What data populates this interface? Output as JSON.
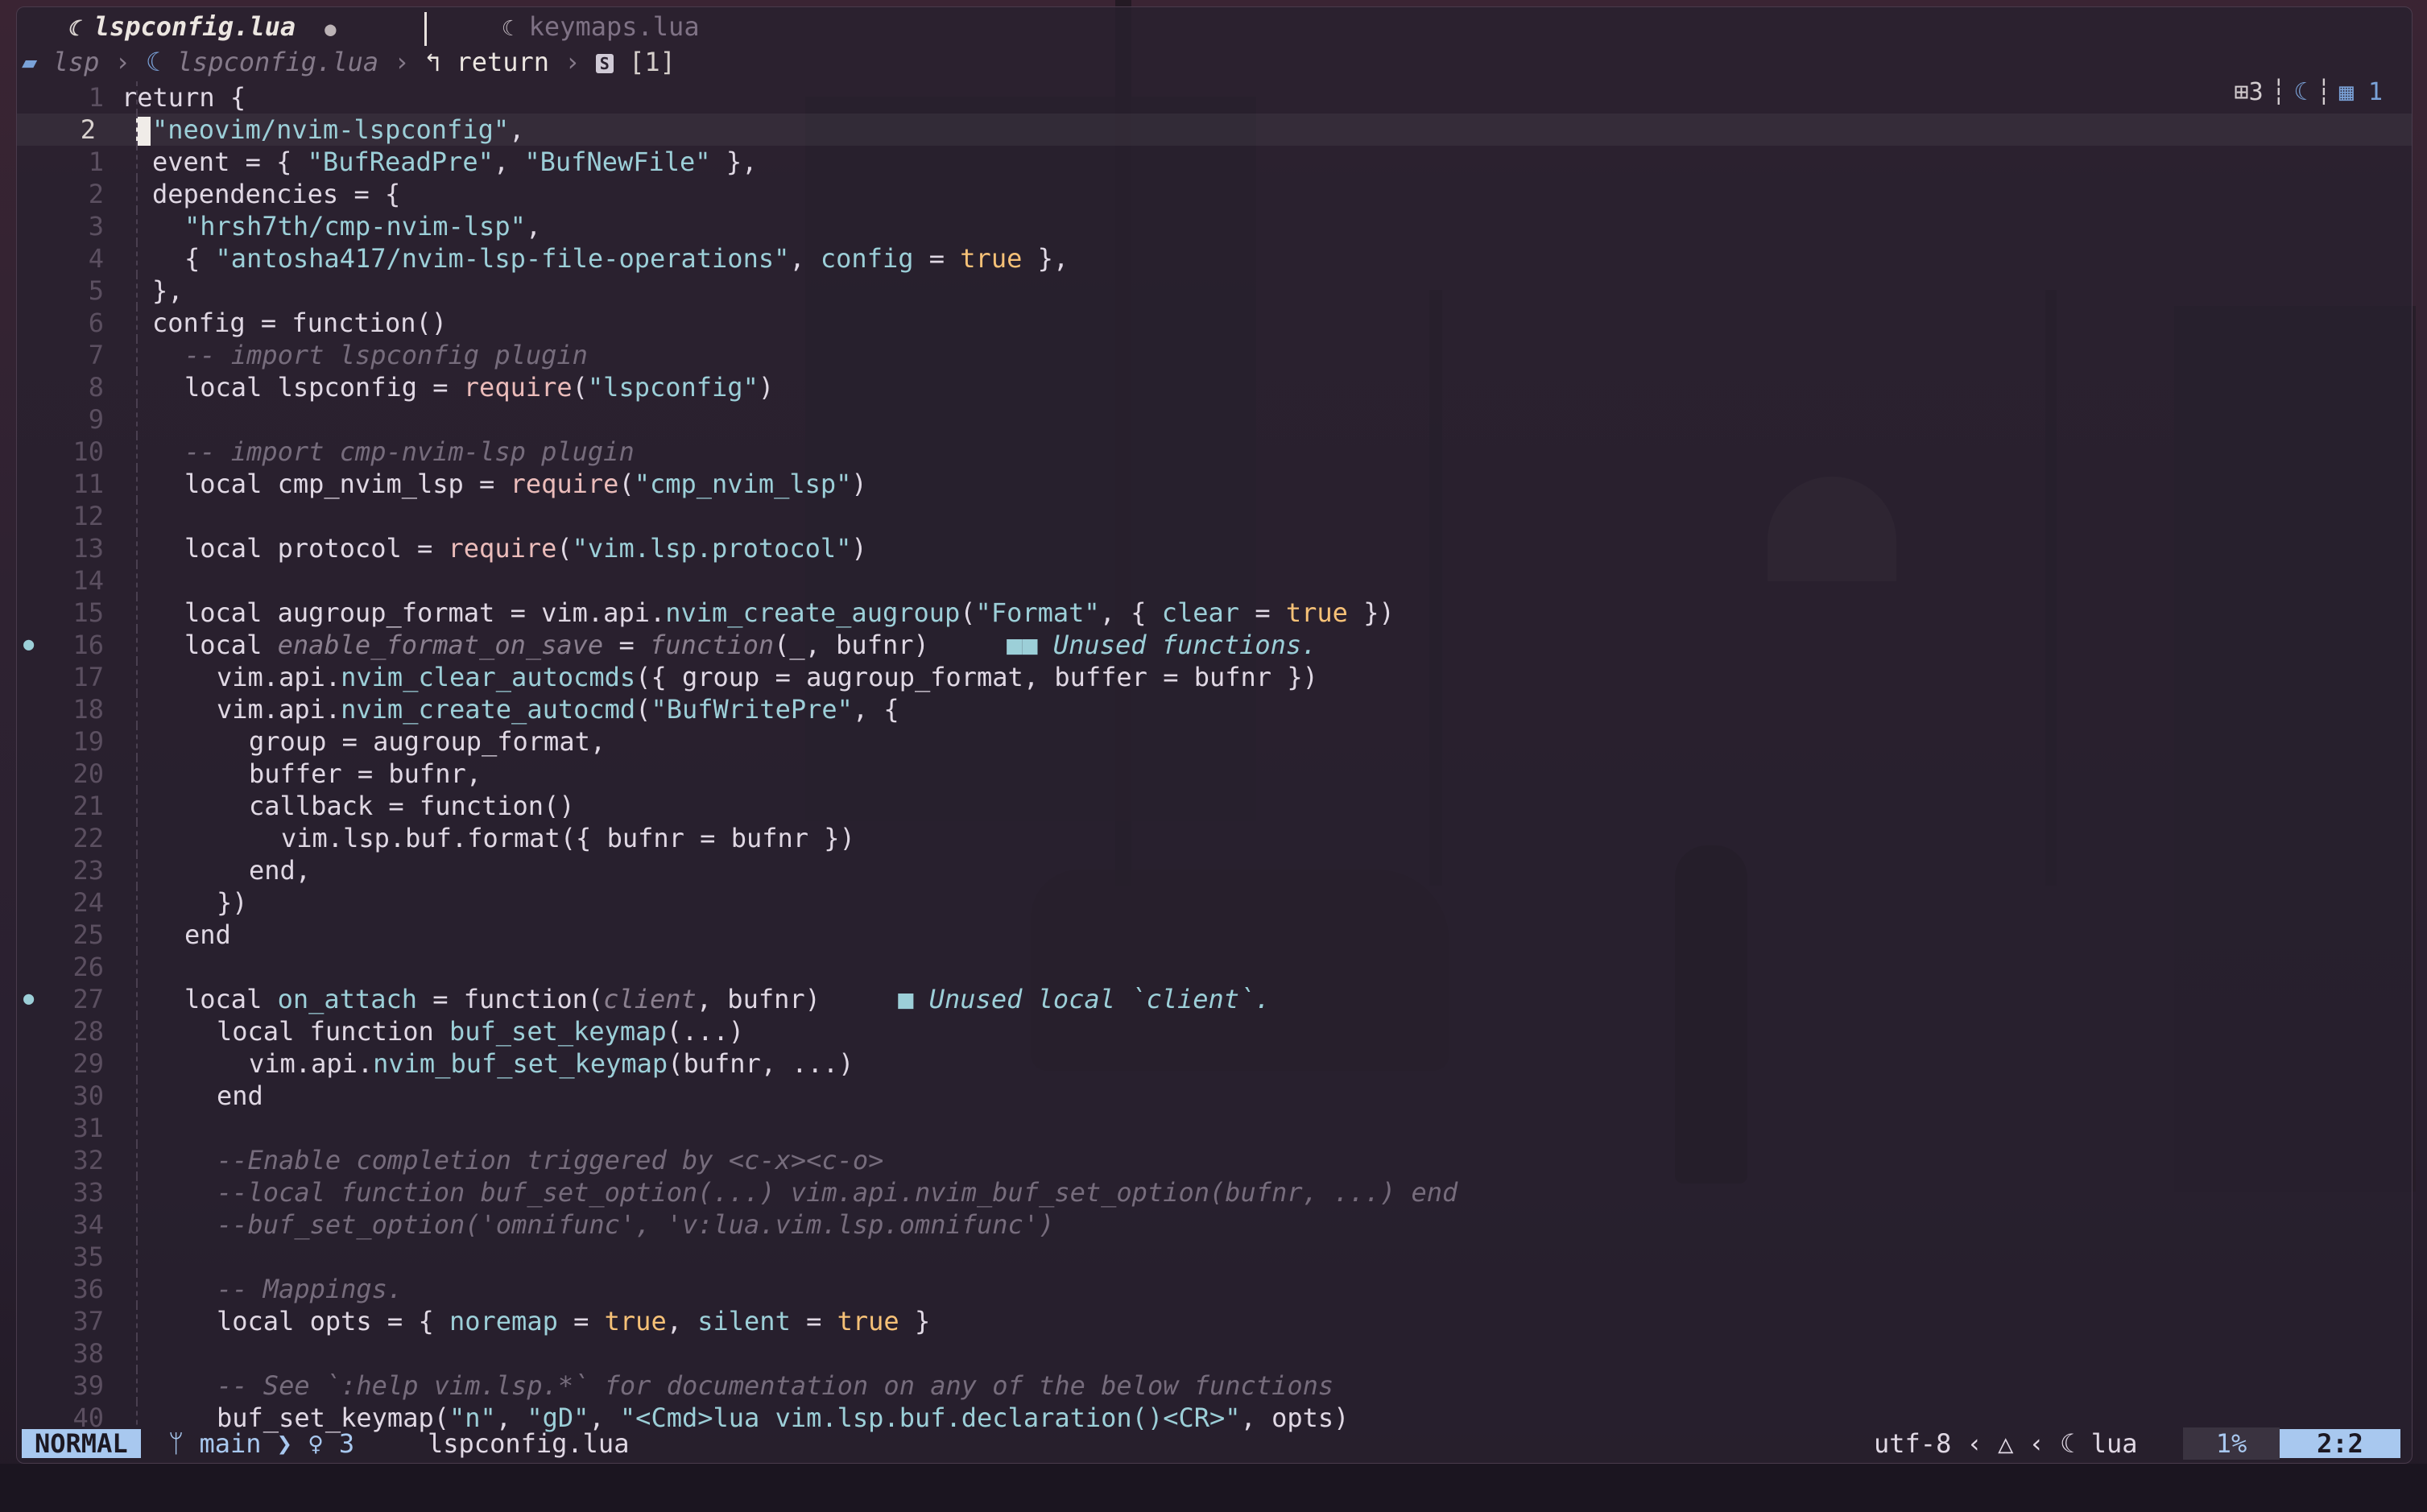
{
  "tabs": [
    {
      "icon": "moon-icon",
      "label": "lspconfig.lua",
      "modified_mark": "●",
      "active": true
    },
    {
      "icon": "moon-icon",
      "label": "keymaps.lua",
      "active": false
    }
  ],
  "winbar": {
    "folder": "lsp",
    "file": "lspconfig.lua",
    "scope": "return",
    "index": "[1]",
    "sep": "›"
  },
  "right_info": {
    "count": "3",
    "buffers": "1"
  },
  "cursor_line_number": "2",
  "diagnostics": {
    "line16": "■■ Unused functions.",
    "line27": "■ Unused local `client`."
  },
  "status": {
    "mode": "NORMAL",
    "branch": "main",
    "hints": "3",
    "filename": "lspconfig.lua",
    "encoding": "utf-8",
    "filetype": "lua",
    "percent": "1%",
    "position": "2:2"
  },
  "colors": {
    "accent": "#a8c8ef",
    "string": "#9ccfd8",
    "boolean": "#f6c177",
    "comment": "#766c7c"
  }
}
